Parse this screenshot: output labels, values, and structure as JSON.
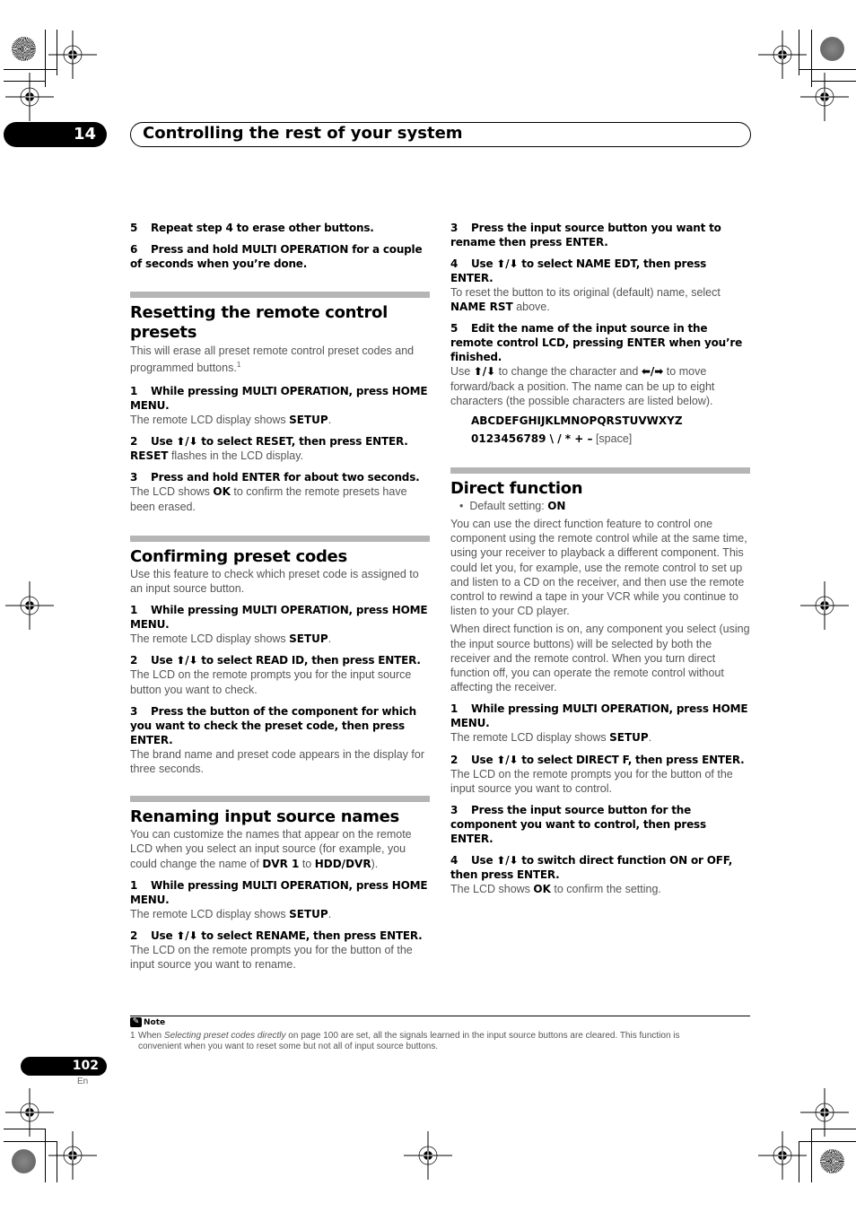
{
  "header": {
    "chapter_number": "14",
    "chapter_title": "Controlling the rest of your system"
  },
  "left_column": {
    "intro_steps": [
      {
        "num": "5",
        "text": "Repeat step 4 to erase other buttons."
      },
      {
        "num": "6",
        "text": "Press and hold MULTI OPERATION for a couple of seconds when you’re done."
      }
    ],
    "resetting": {
      "title": "Resetting the remote control presets",
      "intro": "This will erase all preset remote control preset codes and programmed buttons.",
      "intro_footnote": "1",
      "step1": {
        "num": "1",
        "text": "While pressing MULTI OPERATION, press HOME MENU."
      },
      "step1_body_pre": "The remote LCD display shows ",
      "step1_body_bold": "SETUP",
      "step1_body_post": ".",
      "step2": {
        "num": "2",
        "text_pre": "Use ",
        "arrows": "⬆/⬇",
        "text_post": " to select RESET, then press ENTER."
      },
      "step2_body_bold": "RESET",
      "step2_body_post": " flashes in the LCD display.",
      "step3": {
        "num": "3",
        "text": "Press and hold ENTER for about two seconds."
      },
      "step3_body_pre": "The LCD shows ",
      "step3_body_bold": "OK",
      "step3_body_post": " to confirm the remote presets have been erased."
    },
    "confirming": {
      "title": "Confirming preset codes",
      "intro": "Use this feature to check which preset code is assigned to an input source button.",
      "step1": {
        "num": "1",
        "text": "While pressing MULTI OPERATION, press HOME MENU."
      },
      "step1_body_pre": "The remote LCD display shows ",
      "step1_body_bold": "SETUP",
      "step1_body_post": ".",
      "step2": {
        "num": "2",
        "text_pre": "Use ",
        "arrows": "⬆/⬇",
        "text_post": " to select READ ID, then press ENTER."
      },
      "step2_body": "The LCD on the remote prompts you for the input source button you want to check.",
      "step3": {
        "num": "3",
        "text": "Press the button of the component for which you want to check the preset code, then press ENTER."
      },
      "step3_body": "The brand name and preset code appears in the display for three seconds."
    },
    "renaming": {
      "title": "Renaming input source names",
      "intro_pre": "You can customize the names that appear on the remote LCD when you select an input source (for example, you could change the name of ",
      "intro_bold1": "DVR 1",
      "intro_mid": " to ",
      "intro_bold2": "HDD/DVR",
      "intro_post": ").",
      "step1": {
        "num": "1",
        "text": "While pressing MULTI OPERATION, press HOME MENU."
      },
      "step1_body_pre": "The remote LCD display shows ",
      "step1_body_bold": "SETUP",
      "step1_body_post": ".",
      "step2": {
        "num": "2",
        "text_pre": "Use ",
        "arrows": "⬆/⬇",
        "text_post": " to select RENAME, then press ENTER."
      },
      "step2_body": "The LCD on the remote prompts you for the button of the input source you want to rename."
    }
  },
  "right_column": {
    "renaming_cont": {
      "step3": {
        "num": "3",
        "text": "Press the input source button you want to rename then press ENTER."
      },
      "step4": {
        "num": "4",
        "text_pre": "Use ",
        "arrows": "⬆/⬇",
        "text_post": " to select NAME EDT, then press ENTER."
      },
      "step4_body_pre": "To reset the button to its original (default) name, select ",
      "step4_body_bold": "NAME RST",
      "step4_body_post": " above.",
      "step5": {
        "num": "5",
        "text": "Edit the name of the input source in the remote control LCD, pressing ENTER when you’re finished."
      },
      "step5_body_pre": "Use ",
      "step5_arrows_ud": "⬆/⬇",
      "step5_body_mid": " to change the character and ",
      "step5_arrows_lr": "⬅/➡",
      "step5_body_post": " to move forward/back a position. The name can be up to eight characters (the possible characters are listed below).",
      "chars_line1": "ABCDEFGHIJKLMNOPQRSTUVWXYZ",
      "chars_line2": "0123456789 \\ / * + –",
      "chars_space": " [space]"
    },
    "direct": {
      "title": "Direct function",
      "default_label": "Default setting: ",
      "default_value": "ON",
      "para1": "You can use the direct function feature to control one component using the remote control while at the same time, using your receiver to playback a different component. This could let you, for example, use the remote control to set up and listen to a CD on the receiver, and then use the remote control to rewind a tape in your VCR while you continue to listen to your CD player.",
      "para2": "When direct function is on, any component you select (using the input source buttons) will be selected by both the receiver and the remote control. When you turn direct function off, you can operate the remote control without affecting the receiver.",
      "step1": {
        "num": "1",
        "text": "While pressing MULTI OPERATION, press HOME MENU."
      },
      "step1_body_pre": "The remote LCD display shows ",
      "step1_body_bold": "SETUP",
      "step1_body_post": ".",
      "step2": {
        "num": "2",
        "text_pre": "Use ",
        "arrows": "⬆/⬇",
        "text_post": " to select DIRECT F, then press ENTER."
      },
      "step2_body": "The LCD on the remote prompts you for the button of the input source you want to control.",
      "step3": {
        "num": "3",
        "text": "Press the input source button for the component you want to control, then press ENTER."
      },
      "step4": {
        "num": "4",
        "text_pre": "Use ",
        "arrows": "⬆/⬇",
        "text_post": " to switch direct function ON or OFF, then press ENTER."
      },
      "step4_body_pre": "The LCD shows ",
      "step4_body_bold": "OK",
      "step4_body_post": " to confirm the setting."
    }
  },
  "note": {
    "label": "Note",
    "icon": "pencil-note-icon",
    "fn_num": "1",
    "fn_pre": "When ",
    "fn_italic": "Selecting preset codes directly",
    "fn_line1_post": " on page 100 are set, all the signals learned in the input source buttons are cleared. This function is",
    "fn_line2": "convenient when you want to reset some but not all of input source buttons."
  },
  "footer": {
    "page_number": "102",
    "language": "En"
  }
}
